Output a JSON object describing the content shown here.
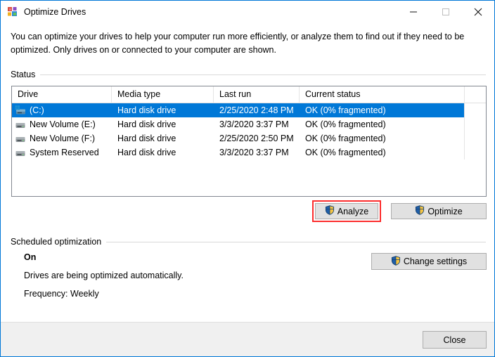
{
  "window": {
    "title": "Optimize Drives",
    "icon": "defrag-icon",
    "accent": "#0078d7",
    "controls": {
      "minimize": "minimize-icon",
      "maximize": "maximize-icon",
      "close": "close-icon"
    }
  },
  "description": "You can optimize your drives to help your computer run more efficiently, or analyze them to find out if they need to be optimized. Only drives on or connected to your computer are shown.",
  "status_section": {
    "label": "Status",
    "columns": [
      "Drive",
      "Media type",
      "Last run",
      "Current status"
    ],
    "rows": [
      {
        "drive": "(C:)",
        "icon": "windows-drive-icon",
        "media_type": "Hard disk drive",
        "last_run": "2/25/2020 2:48 PM",
        "current_status": "OK (0% fragmented)",
        "selected": true
      },
      {
        "drive": "New Volume (E:)",
        "icon": "drive-icon",
        "media_type": "Hard disk drive",
        "last_run": "3/3/2020 3:37 PM",
        "current_status": "OK (0% fragmented)",
        "selected": false
      },
      {
        "drive": "New Volume (F:)",
        "icon": "drive-icon",
        "media_type": "Hard disk drive",
        "last_run": "2/25/2020 2:50 PM",
        "current_status": "OK (0% fragmented)",
        "selected": false
      },
      {
        "drive": "System Reserved",
        "icon": "drive-icon",
        "media_type": "Hard disk drive",
        "last_run": "3/3/2020 3:37 PM",
        "current_status": "OK (0% fragmented)",
        "selected": false
      }
    ],
    "buttons": {
      "analyze": "Analyze",
      "optimize": "Optimize"
    },
    "highlight": {
      "target": "analyze",
      "color": "#fc2d2d"
    }
  },
  "scheduled_section": {
    "label": "Scheduled optimization",
    "state": "On",
    "detail": "Drives are being optimized automatically.",
    "frequency": "Frequency: Weekly",
    "change_settings": "Change settings"
  },
  "footer": {
    "close": "Close"
  }
}
